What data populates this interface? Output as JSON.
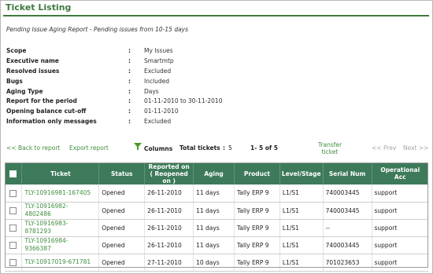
{
  "page": {
    "title": "Ticket Listing",
    "subtitle": "Pending Issue Aging Report - Pending issues from 10-15 days"
  },
  "criteria": [
    {
      "label": "Scope",
      "value": "My Issues"
    },
    {
      "label": "Executive name",
      "value": "Smartmtp"
    },
    {
      "label": "Resolved issues",
      "value": "Excluded"
    },
    {
      "label": "Bugs",
      "value": "Included"
    },
    {
      "label": "Aging Type",
      "value": "Days"
    },
    {
      "label": "Report for the period",
      "value": "01-11-2010 to 30-11-2010"
    },
    {
      "label": "Opening balance cut-off",
      "value": "01-11-2010"
    },
    {
      "label": "Information only messages",
      "value": "Excluded"
    }
  ],
  "toolbar": {
    "back_label": "<< Back to report",
    "export_label": "Export report",
    "columns_icon": "funnel-icon",
    "columns_label": "Columns",
    "total_label": "Total tickets",
    "total_sep": ":",
    "total_value": "5",
    "range_label": "1- 5 of 5",
    "transfer_line1": "Transfer",
    "transfer_line2": "ticket",
    "prev_label": "<< Prev",
    "next_label": "Next >>"
  },
  "table": {
    "headers": {
      "ticket": "Ticket",
      "status": "Status",
      "reported_l1": "Reported on",
      "reported_l2": "( Reopened",
      "reported_l3": "on )",
      "aging": "Aging",
      "product": "Product",
      "level": "Level/Stage",
      "serial": "Serial Num",
      "opacc_l1": "Operational",
      "opacc_l2": "Acc"
    },
    "rows": [
      {
        "ticket_l1": "TLY-10916981-167405",
        "ticket_l2": "",
        "status": "Opened",
        "reported": "26-11-2010",
        "aging": "11 days",
        "product": "Tally ERP 9",
        "level": "L1/S1",
        "serial": "740003445",
        "opacc": "support"
      },
      {
        "ticket_l1": "TLY-10916982-",
        "ticket_l2": "4802486",
        "status": "Opened",
        "reported": "26-11-2010",
        "aging": "11 days",
        "product": "Tally ERP 9",
        "level": "L1/S1",
        "serial": "740003445",
        "opacc": "support"
      },
      {
        "ticket_l1": "TLY-10916983-",
        "ticket_l2": "8781293",
        "status": "Opened",
        "reported": "26-11-2010",
        "aging": "11 days",
        "product": "Tally ERP 9",
        "level": "L1/S1",
        "serial": "--",
        "opacc": "support"
      },
      {
        "ticket_l1": "TLY-10916984-",
        "ticket_l2": "9366387",
        "status": "Opened",
        "reported": "26-11-2010",
        "aging": "11 days",
        "product": "Tally ERP 9",
        "level": "L1/S1",
        "serial": "740003445",
        "opacc": "support"
      },
      {
        "ticket_l1": "TLY-10917019-671781",
        "ticket_l2": "",
        "status": "Opened",
        "reported": "27-11-2010",
        "aging": "10 days",
        "product": "Tally ERP 9",
        "level": "L1/S1",
        "serial": "701023653",
        "opacc": "support"
      }
    ]
  },
  "colors": {
    "accent": "#3e7a3e",
    "header_bg": "#3d7a5a",
    "link": "#3f8f3f",
    "disabled": "#a6a6a6"
  }
}
